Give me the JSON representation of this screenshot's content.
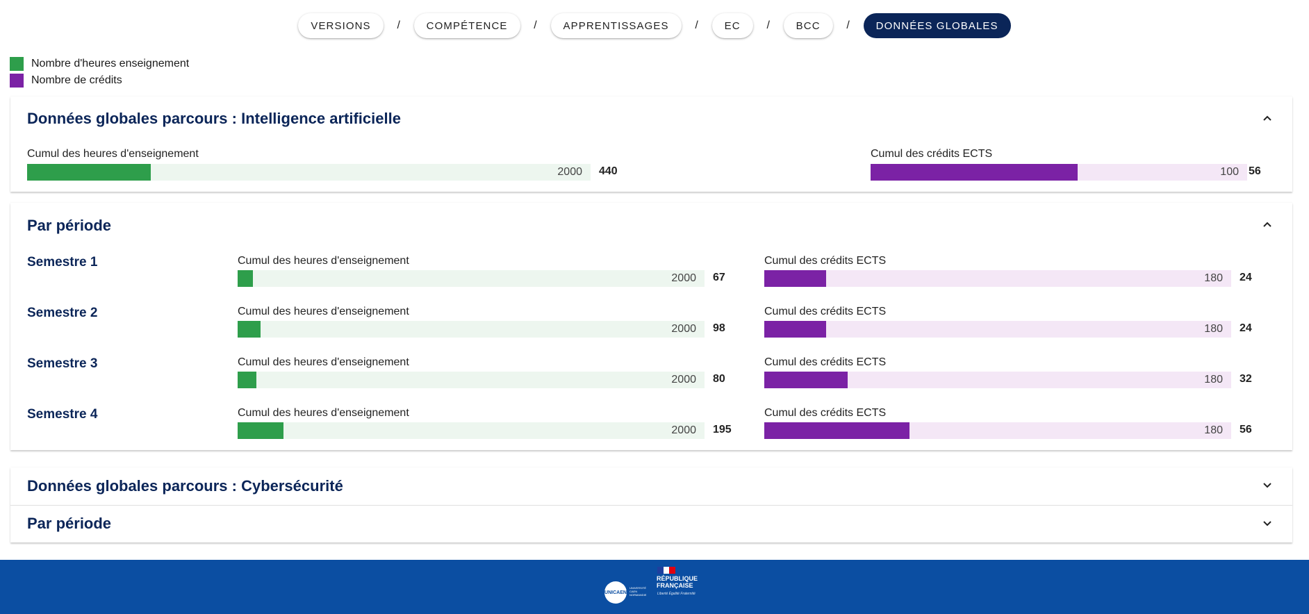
{
  "breadcrumb": {
    "items": [
      "VERSIONS",
      "COMPÉTENCE",
      "APPRENTISSAGES",
      "EC",
      "BCC",
      "DONNÉES GLOBALES"
    ],
    "separator": "/",
    "active_index": 5
  },
  "legend": {
    "hours_label": "Nombre d'heures enseignement",
    "credits_label": "Nombre de crédits"
  },
  "colors": {
    "hours": "#2e9e4b",
    "hours_track": "#edf6ef",
    "credits": "#7b22a5",
    "credits_track": "#f4e7f6",
    "primary": "#0b2558",
    "footer": "#0b4ea2"
  },
  "sections": {
    "ia_global": {
      "title": "Données globales parcours : Intelligence artificielle",
      "hours": {
        "label": "Cumul des heures d'enseignement",
        "max": "2000",
        "value": "440",
        "fill_fraction": 0.219
      },
      "credits": {
        "label": "Cumul des crédits ECTS",
        "max": "100",
        "value": "56",
        "fill_fraction": 0.55
      }
    },
    "ia_periods": {
      "title": "Par période",
      "semesters": [
        {
          "name": "Semestre 1",
          "hours": {
            "label": "Cumul des heures d'enseignement",
            "max": "2000",
            "value": "67",
            "fill_fraction": 0.033
          },
          "credits": {
            "label": "Cumul des crédits ECTS",
            "max": "180",
            "value": "24",
            "fill_fraction": 0.133
          }
        },
        {
          "name": "Semestre 2",
          "hours": {
            "label": "Cumul des heures d'enseignement",
            "max": "2000",
            "value": "98",
            "fill_fraction": 0.049
          },
          "credits": {
            "label": "Cumul des crédits ECTS",
            "max": "180",
            "value": "24",
            "fill_fraction": 0.133
          }
        },
        {
          "name": "Semestre 3",
          "hours": {
            "label": "Cumul des heures d'enseignement",
            "max": "2000",
            "value": "80",
            "fill_fraction": 0.04
          },
          "credits": {
            "label": "Cumul des crédits ECTS",
            "max": "180",
            "value": "32",
            "fill_fraction": 0.178
          }
        },
        {
          "name": "Semestre 4",
          "hours": {
            "label": "Cumul des heures d'enseignement",
            "max": "2000",
            "value": "195",
            "fill_fraction": 0.098
          },
          "credits": {
            "label": "Cumul des crédits ECTS",
            "max": "180",
            "value": "56",
            "fill_fraction": 0.311
          }
        }
      ]
    },
    "cyber_global": {
      "title": "Données globales parcours : Cybersécurité"
    },
    "cyber_periods": {
      "title": "Par période"
    }
  },
  "footer": {
    "unicaen_logo": "UNICAEN",
    "unicaen_text": "UNIVERSITÉ CAEN NORMANDIE",
    "rf_line1": "RÉPUBLIQUE",
    "rf_line2": "FRANÇAISE",
    "rf_motto": "Liberté Égalité Fraternité"
  }
}
